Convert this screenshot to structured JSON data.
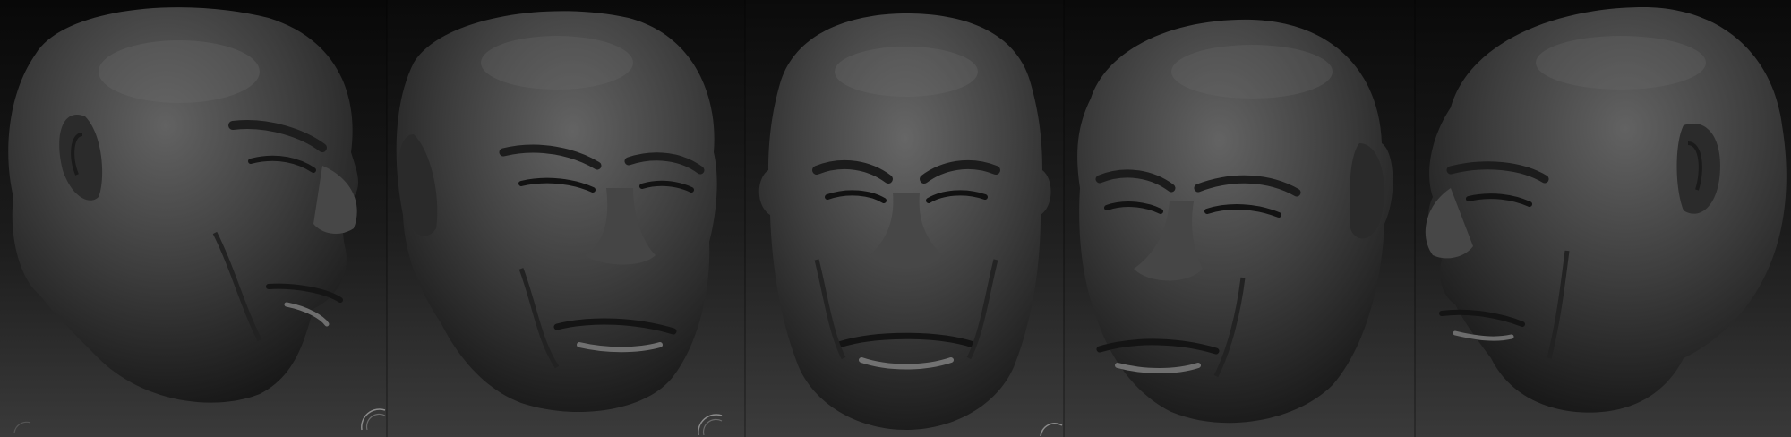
{
  "image": {
    "subject": "",
    "views": [
      {
        "name": "three-quarter-right"
      },
      {
        "name": "three-quarter-front-right"
      },
      {
        "name": "front"
      },
      {
        "name": "three-quarter-front-left"
      },
      {
        "name": "profile-left"
      }
    ]
  },
  "colors": {
    "background_top": "#0a0a0a",
    "background_bottom": "#3a3a3a",
    "clay_light": "#6b6b6b",
    "clay_mid": "#3f3f3f",
    "clay_dark": "#1c1c1c",
    "specular": "#9a9a9a"
  },
  "icons": {
    "corner_gizmo": "arc-gizmo-icon"
  }
}
